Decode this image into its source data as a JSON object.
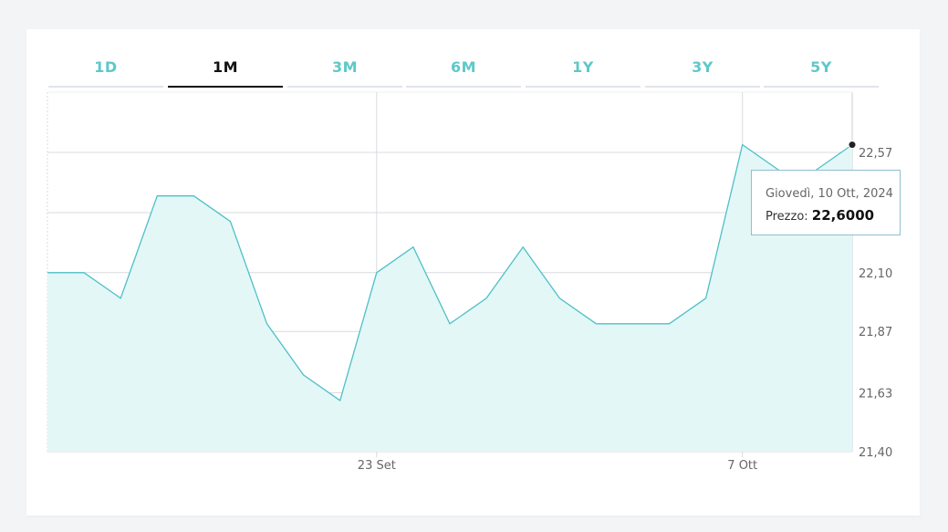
{
  "tabs": [
    {
      "label": "1D",
      "active": false
    },
    {
      "label": "1M",
      "active": true
    },
    {
      "label": "3M",
      "active": false
    },
    {
      "label": "6M",
      "active": false
    },
    {
      "label": "1Y",
      "active": false
    },
    {
      "label": "3Y",
      "active": false
    },
    {
      "label": "5Y",
      "active": false
    }
  ],
  "tooltip": {
    "date": "Giovedì, 10 Ott, 2024",
    "label": "Prezzo:",
    "value": "22,6000"
  },
  "colors": {
    "line": "#4fc0c6",
    "area": "#e3f7f7",
    "tab_accent": "#5ec8c8",
    "grid": "#d7dbe0"
  },
  "chart_data": {
    "type": "area",
    "y_ticks": [
      {
        "value": 22.57,
        "label": "22,57"
      },
      {
        "value": 22.1,
        "label": "22,10"
      },
      {
        "value": 21.87,
        "label": "21,87"
      },
      {
        "value": 21.63,
        "label": "21,63"
      },
      {
        "value": 21.4,
        "label": "21,40"
      }
    ],
    "x_ticks": [
      {
        "index": 9,
        "label": "23 Set"
      },
      {
        "index": 19,
        "label": "7 Ott"
      }
    ],
    "ylim": [
      21.4,
      22.8
    ],
    "values": [
      22.1,
      22.1,
      22.0,
      22.4,
      22.4,
      22.3,
      21.9,
      21.7,
      21.6,
      22.1,
      22.2,
      21.9,
      22.0,
      22.2,
      22.0,
      21.9,
      21.9,
      21.9,
      22.0,
      22.6,
      22.5,
      22.5,
      22.6
    ],
    "highlight_index": 22,
    "grid": true
  }
}
